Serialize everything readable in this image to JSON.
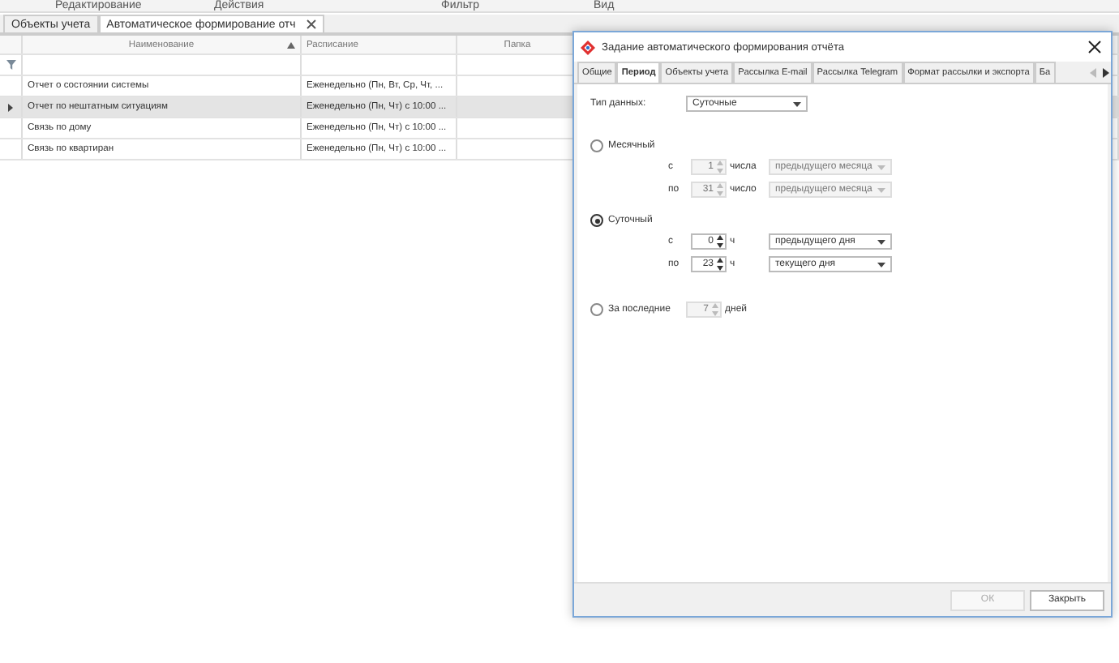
{
  "ribbon_groups": [
    "Редактирование",
    "Действия",
    "Фильтр",
    "Вид"
  ],
  "doc_tabs": [
    {
      "label": "Объекты учета",
      "selected": false,
      "closable": false
    },
    {
      "label": "Автоматическое формирование отч",
      "selected": true,
      "closable": true
    }
  ],
  "grid": {
    "columns": [
      {
        "label": "Наименование",
        "sorted": true
      },
      {
        "label": "Расписание",
        "sorted": false
      },
      {
        "label": "Папка",
        "sorted": false
      }
    ],
    "rows": [
      {
        "name": "Отчет о состоянии системы",
        "schedule": "Еженедельно (Пн, Вт, Ср, Чт, ...",
        "selected": false
      },
      {
        "name": "Отчет по нештатным ситуациям",
        "schedule": "Еженедельно (Пн, Чт) с 10:00 ...",
        "selected": true
      },
      {
        "name": "Связь по дому",
        "schedule": "Еженедельно (Пн, Чт) с 10:00 ...",
        "selected": false
      },
      {
        "name": "Связь по квартиран",
        "schedule": "Еженедельно (Пн, Чт) с 10:00 ...",
        "selected": false
      }
    ]
  },
  "dialog": {
    "title": "Задание автоматического формирования отчёта",
    "tabs": [
      {
        "label": "Общие",
        "selected": false
      },
      {
        "label": "Период",
        "selected": true
      },
      {
        "label": "Объекты учета",
        "selected": false
      },
      {
        "label": "Рассылка E-mail",
        "selected": false
      },
      {
        "label": "Рассылка Telegram",
        "selected": false
      },
      {
        "label": "Формат рассылки и экспорта",
        "selected": false
      },
      {
        "label": "Ба",
        "selected": false
      }
    ],
    "data_type": {
      "label": "Тип данных:",
      "value": "Суточные"
    },
    "options": [
      {
        "kind": "range",
        "label": "Месячный",
        "selected": false,
        "rows": [
          {
            "prefix": "с",
            "value": "1",
            "unit": "числа",
            "period": "предыдущего месяца"
          },
          {
            "prefix": "по",
            "value": "31",
            "unit": "число",
            "period": "предыдущего месяца"
          }
        ]
      },
      {
        "kind": "range",
        "label": "Суточный",
        "selected": true,
        "rows": [
          {
            "prefix": "с",
            "value": "0",
            "unit": "ч",
            "period": "предыдущего дня"
          },
          {
            "prefix": "по",
            "value": "23",
            "unit": "ч",
            "period": "текущего дня"
          }
        ]
      },
      {
        "kind": "last",
        "label": "За последние",
        "selected": false,
        "value": "7",
        "unit": "дней"
      }
    ],
    "buttons": [
      {
        "label": "ОК",
        "disabled": true
      },
      {
        "label": "Закрыть",
        "disabled": false
      }
    ]
  }
}
